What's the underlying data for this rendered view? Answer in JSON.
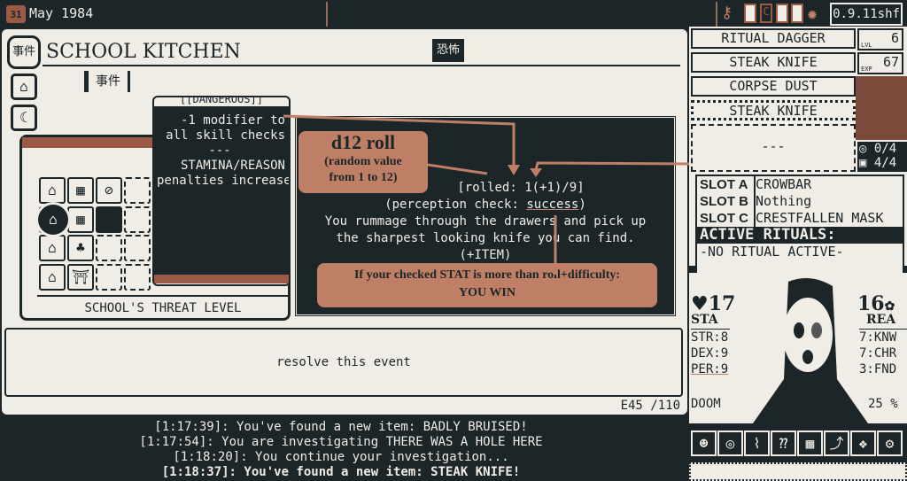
{
  "topbar": {
    "calendar_day": "31",
    "date": "May 1984",
    "version": "0.9.11shf",
    "icons": [
      "key-icon",
      "key-card-icon",
      "letter-c-icon",
      "figure-icon",
      "key-card-icon",
      "old-god-icon"
    ]
  },
  "location": {
    "badge": "事件",
    "title": "SCHOOL KITCHEN",
    "sub_badge": "事件",
    "stamp": "恐怖"
  },
  "tooltip": {
    "header": "[[DANGEROUS]]",
    "line1": "-1 modifier to",
    "line2": "all skill checks",
    "sep": "---",
    "line3": "STAMINA/REASON",
    "line4": "penalties increase"
  },
  "map": {
    "threat_label": "SCHOOL'S THREAT LEVEL"
  },
  "event": {
    "rolled": "[rolled: 1(+1)/9]",
    "check_prefix": "(perception check: ",
    "check_result": "success",
    "check_suffix": ")",
    "text1": "You rummage through the drawers and pick up",
    "text2": "the sharpest looking knife you can find.",
    "reward": "(+ITEM)"
  },
  "annotations": {
    "roll_title": "d12 roll",
    "roll_sub1": "(random value",
    "roll_sub2": "from 1 to 12)",
    "win1": "If your checked STAT is more than roll+difficulty:",
    "win2": "YOU WIN",
    "color": "#bf7f66"
  },
  "resolve": {
    "label": "resolve this event",
    "counter": "E45 /110"
  },
  "log": [
    "[1:17:39]: You've found a new item: BADLY BRUISED!",
    "[1:17:54]: You are investigating THERE WAS A HOLE HERE",
    "[1:18:20]: You continue your investigation...",
    "[1:18:37]: You've found a new item: STEAK KNIFE!"
  ],
  "inventory": {
    "items": [
      "RITUAL DAGGER",
      "STEAK KNIFE",
      "CORPSE DUST",
      "STEAK KNIFE"
    ],
    "empty": "---",
    "lvl_label": "LVL",
    "lvl": "6",
    "exp_label": "EXP",
    "exp": "67",
    "spells": "0/4",
    "items_count": "4/4"
  },
  "slots": [
    {
      "label": "SLOT A",
      "value": "CROWBAR"
    },
    {
      "label": "SLOT B",
      "value": "Nothing"
    },
    {
      "label": "SLOT C",
      "value": "CRESTFALLEN MASK"
    }
  ],
  "rituals": {
    "header": "ACTIVE RITUALS:",
    "value": "-NO RITUAL ACTIVE-"
  },
  "character": {
    "sta": "17",
    "sta_label": "STA",
    "rea": "16",
    "rea_label": "REA",
    "left_stats": [
      "STR:8",
      "DEX:9",
      "PER:9"
    ],
    "right_stats": [
      "7:KNW",
      "7:CHR",
      "3:FND"
    ],
    "doom_label": "DOOM",
    "doom": "25 %"
  },
  "toolbar": [
    "☻",
    "◎",
    "⌇",
    "⁇",
    "▦",
    "⤴",
    "❖",
    "⚙"
  ],
  "colors": {
    "background": "#1c2628",
    "paper": "#f0ece6",
    "accent": "#bf7f66"
  }
}
